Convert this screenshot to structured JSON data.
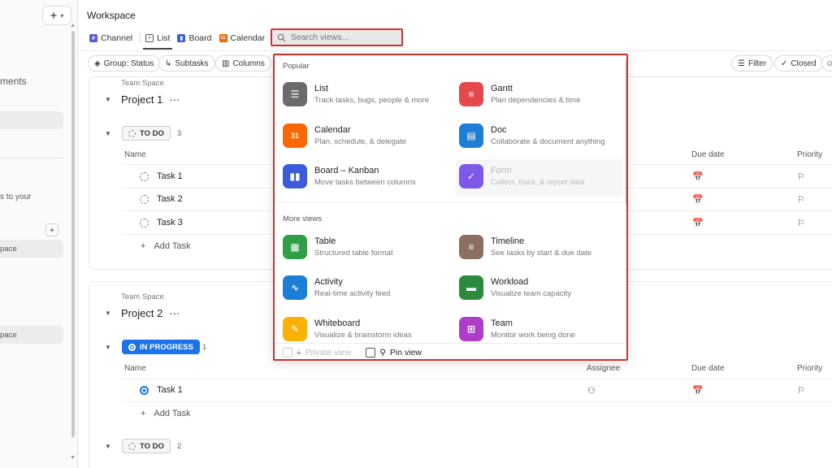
{
  "sidebar": {
    "add_button": "+",
    "items": [
      "ments",
      "s to your",
      "pace",
      "pace"
    ]
  },
  "header": {
    "title": "Workspace",
    "tabs": [
      {
        "label": "Channel",
        "color": "#5b5bd6"
      },
      {
        "label": "List",
        "color": "#555555"
      },
      {
        "label": "Board",
        "color": "#3b5bdb"
      },
      {
        "label": "Calendar",
        "color": "#f76707"
      }
    ],
    "search": {
      "placeholder": "Search views...",
      "value": ""
    }
  },
  "toolbar": {
    "group_status": "Group: Status",
    "subtasks": "Subtasks",
    "columns": "Columns",
    "filter": "Filter",
    "closed": "Closed"
  },
  "columns": {
    "name": "Name",
    "assignee": "Assignee",
    "due_date": "Due date",
    "priority": "Priority"
  },
  "projects": [
    {
      "space": "Team Space",
      "title": "Project 1",
      "group": {
        "status": "TO DO",
        "count": "3"
      },
      "tasks": [
        "Task 1",
        "Task 2",
        "Task 3"
      ],
      "add_task": "Add Task"
    },
    {
      "space": "Team Space",
      "title": "Project 2",
      "group": {
        "status": "IN PROGRESS",
        "count": "1"
      },
      "tasks": [
        "Task 1"
      ],
      "add_task": "Add Task",
      "next_group": {
        "status": "TO DO",
        "count": "2"
      }
    }
  ],
  "dropdown": {
    "popular_label": "Popular",
    "more_label": "More views",
    "popular": [
      {
        "name": "List",
        "desc": "Track tasks, bugs, people & more",
        "color": "#6b6b6b",
        "icon": "list-icon"
      },
      {
        "name": "Gantt",
        "desc": "Plan dependencies & time",
        "color": "#e5484d",
        "icon": "gantt-icon"
      },
      {
        "name": "Calendar",
        "desc": "Plan, schedule, & delegate",
        "color": "#f76707",
        "icon": "calendar-icon",
        "icon_text": "31"
      },
      {
        "name": "Doc",
        "desc": "Collaborate & document anything",
        "color": "#1c7ed6",
        "icon": "doc-icon"
      },
      {
        "name": "Board – Kanban",
        "desc": "Move tasks between columns",
        "color": "#3b5bdb",
        "icon": "board-icon"
      },
      {
        "name": "Form",
        "desc": "Collect, track, & report data",
        "color": "#7048e8",
        "icon": "form-icon"
      }
    ],
    "more": [
      {
        "name": "Table",
        "desc": "Structured table format",
        "color": "#2f9e44",
        "icon": "table-icon"
      },
      {
        "name": "Timeline",
        "desc": "See tasks by start & due date",
        "color": "#8d6e63",
        "icon": "timeline-icon"
      },
      {
        "name": "Activity",
        "desc": "Real-time activity feed",
        "color": "#1c7ed6",
        "icon": "activity-icon"
      },
      {
        "name": "Workload",
        "desc": "Visualize team capacity",
        "color": "#2b8a3e",
        "icon": "workload-icon"
      },
      {
        "name": "Whiteboard",
        "desc": "Visualize & brainstorm ideas",
        "color": "#fab005",
        "icon": "whiteboard-icon"
      },
      {
        "name": "Team",
        "desc": "Monitor work being done",
        "color": "#ae3ec9",
        "icon": "team-icon"
      }
    ],
    "private_view": "Private view",
    "pin_view": "Pin view"
  }
}
